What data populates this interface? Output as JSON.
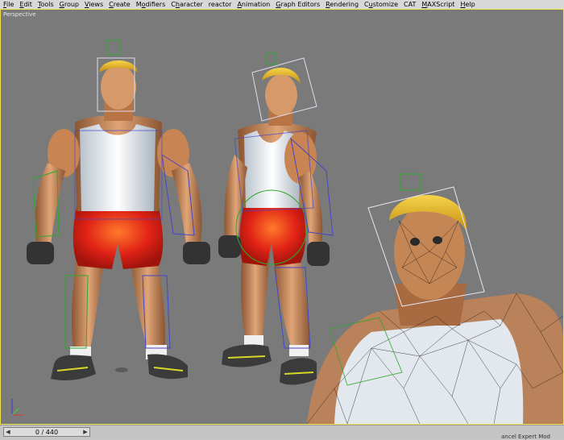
{
  "menubar": {
    "items": [
      {
        "label": "File",
        "key": "F"
      },
      {
        "label": "Edit",
        "key": "E"
      },
      {
        "label": "Tools",
        "key": "T"
      },
      {
        "label": "Group",
        "key": "G"
      },
      {
        "label": "Views",
        "key": "V"
      },
      {
        "label": "Create",
        "key": "C"
      },
      {
        "label": "Modifiers",
        "key": "o"
      },
      {
        "label": "Character",
        "key": "h"
      },
      {
        "label": "reactor",
        "key": ""
      },
      {
        "label": "Animation",
        "key": "A"
      },
      {
        "label": "Graph Editors",
        "key": "G"
      },
      {
        "label": "Rendering",
        "key": "R"
      },
      {
        "label": "Customize",
        "key": "u"
      },
      {
        "label": "CAT",
        "key": ""
      },
      {
        "label": "MAXScript",
        "key": "M"
      },
      {
        "label": "Help",
        "key": "H"
      }
    ]
  },
  "viewport": {
    "label": "Perspective",
    "border_color": "#f2e24a",
    "background": "#7a7a7a"
  },
  "timeline": {
    "frame_label": "0 / 440",
    "prev_icon": "arrow-left-icon",
    "next_icon": "arrow-right-icon"
  },
  "status": {
    "text": "ancel Expert Mod"
  },
  "scene": {
    "colors": {
      "skin": "#c98a5a",
      "shirt": "#e9eef2",
      "shorts": "#e2251a",
      "hair": "#e6b21a",
      "boots": "#3c3c3c",
      "bones_blue": "#4646c8",
      "bones_green": "#2ea82e"
    }
  }
}
